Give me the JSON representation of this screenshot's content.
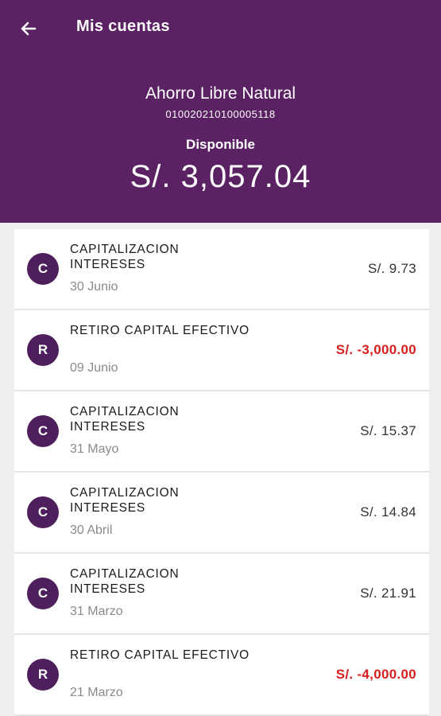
{
  "header": {
    "title": "Mis cuentas",
    "back_icon": "arrow-left-icon"
  },
  "account": {
    "name": "Ahorro Libre Natural",
    "number": "010020210100005118",
    "balance_label": "Disponible",
    "balance": "S/. 3,057.04"
  },
  "transactions": [
    {
      "initial": "C",
      "title": "CAPITALIZACION INTERESES",
      "date": "30 Junio",
      "amount": "S/. 9.73",
      "negative": false
    },
    {
      "initial": "R",
      "title": "RETIRO CAPITAL EFECTIVO",
      "date": "09 Junio",
      "amount": "S/. -3,000.00",
      "negative": true
    },
    {
      "initial": "C",
      "title": "CAPITALIZACION INTERESES",
      "date": "31 Mayo",
      "amount": "S/. 15.37",
      "negative": false
    },
    {
      "initial": "C",
      "title": "CAPITALIZACION INTERESES",
      "date": "30 Abril",
      "amount": "S/. 14.84",
      "negative": false
    },
    {
      "initial": "C",
      "title": "CAPITALIZACION INTERESES",
      "date": "31 Marzo",
      "amount": "S/. 21.91",
      "negative": false
    },
    {
      "initial": "R",
      "title": "RETIRO CAPITAL EFECTIVO",
      "date": "21 Marzo",
      "amount": "S/. -4,000.00",
      "negative": true
    }
  ],
  "colors": {
    "header_bg": "#5a2263",
    "avatar_bg": "#4e1f5c",
    "negative_amount": "#d61f1f"
  }
}
